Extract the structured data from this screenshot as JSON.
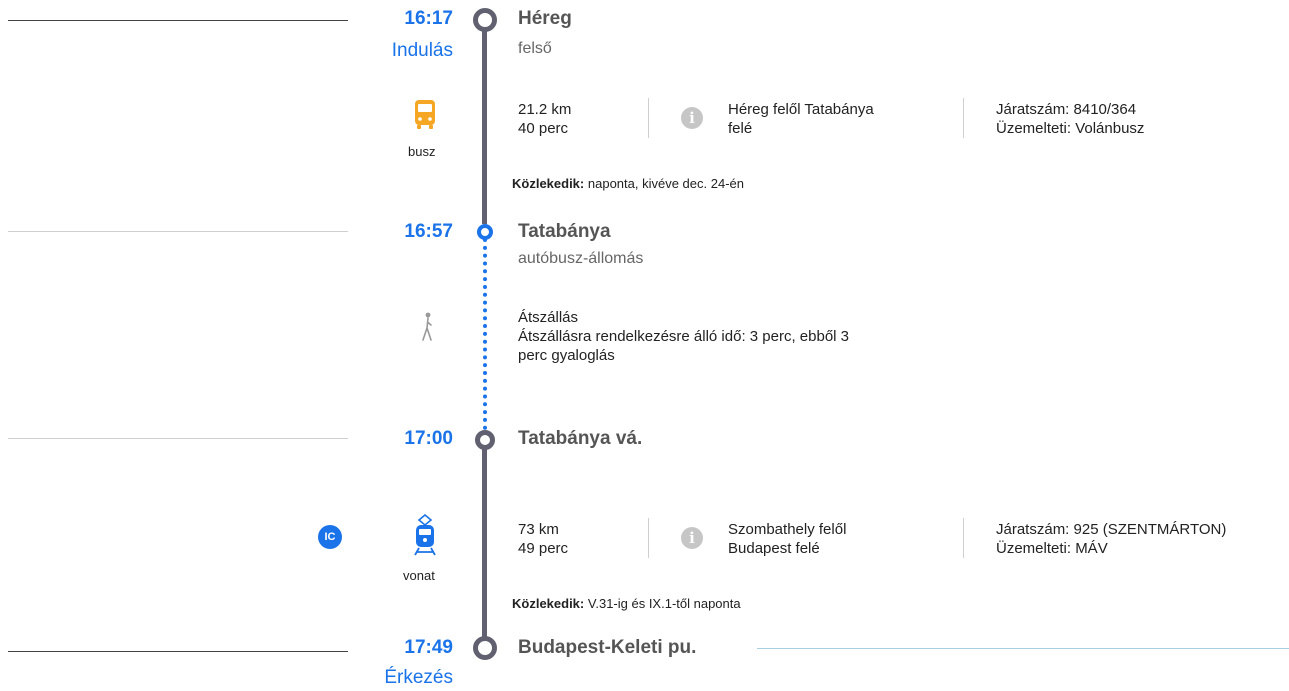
{
  "colors": {
    "accent": "#1a73e8",
    "line_gray": "#606070",
    "bus_orange": "#f5a623",
    "train_blue": "#1a73e8"
  },
  "stops": [
    {
      "time": "16:17",
      "sub_label": "Indulás",
      "name": "Héreg",
      "detail": "felső"
    },
    {
      "time": "16:57",
      "name": "Tatabánya",
      "detail": "autóbusz-állomás"
    },
    {
      "time": "17:00",
      "name": "Tatabánya vá."
    },
    {
      "time": "17:49",
      "sub_label": "Érkezés",
      "name": "Budapest-Keleti pu."
    }
  ],
  "legs": {
    "bus": {
      "mode_icon": "bus-icon",
      "mode_label": "busz",
      "distance": "21.2 km",
      "duration": "40 perc",
      "direction_line1": "Héreg felől Tatabánya",
      "direction_line2": "felé",
      "route_number": "Járatszám: 8410/364",
      "operator": "Üzemelteti: Volánbusz",
      "runs_label": "Közlekedik:",
      "runs_value": "naponta, kivéve dec. 24-én"
    },
    "transfer": {
      "mode_icon": "walk-icon",
      "title": "Átszállás",
      "line1": "Átszállásra rendelkezésre álló idő: 3 perc, ebből 3",
      "line2": "perc gyaloglás"
    },
    "train": {
      "badge": "IC",
      "mode_icon": "train-icon",
      "mode_label": "vonat",
      "distance": "73 km",
      "duration": "49 perc",
      "direction_line1": "Szombathely felől",
      "direction_line2": "Budapest felé",
      "route_number": "Járatszám: 925 (SZENTMÁRTON)",
      "operator": "Üzemelteti: MÁV",
      "runs_label": "Közlekedik:",
      "runs_value": "V.31-ig és IX.1-től naponta"
    }
  }
}
